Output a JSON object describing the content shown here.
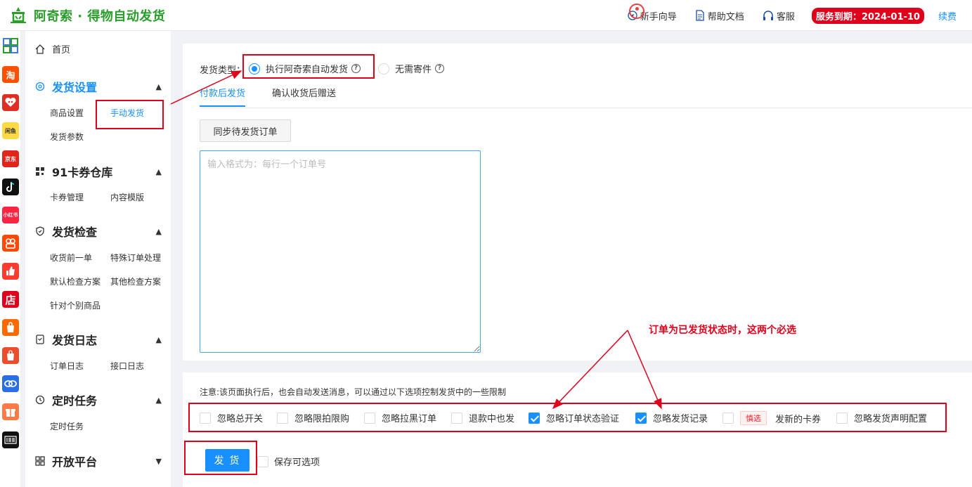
{
  "header": {
    "app_title": "阿奇索 · 得物自动发货",
    "guide": "新手向导",
    "docs": "帮助文档",
    "support": "客服",
    "service_expiry": "服务到期：2024-01-10",
    "renew": "续费"
  },
  "platforms": [
    {
      "icon": "grid-apps-icon",
      "label": "",
      "color": "#ffffff"
    },
    {
      "icon": "taobao-icon",
      "label": "淘",
      "color": "#ff5000"
    },
    {
      "icon": "pinduoduo-icon",
      "label": "",
      "color": "#e02e24"
    },
    {
      "icon": "xianyu-icon",
      "label": "闲鱼",
      "color": "#ffda44"
    },
    {
      "icon": "jd-icon",
      "label": "京东",
      "color": "#e1251b"
    },
    {
      "icon": "douyin-icon",
      "label": "",
      "color": "#111111"
    },
    {
      "icon": "xiaohongshu-icon",
      "label": "小红书",
      "color": "#ff2442"
    },
    {
      "icon": "kuaishou-icon",
      "label": "",
      "color": "#ff4906"
    },
    {
      "icon": "thumbs-up-icon",
      "label": "",
      "color": "#ff3b30"
    },
    {
      "icon": "shop-icon",
      "label": "店",
      "color": "#e0001b"
    },
    {
      "icon": "shopping-bag-icon",
      "label": "",
      "color": "#ff6a00"
    },
    {
      "icon": "shopee-icon",
      "label": "",
      "color": "#ee4d2d"
    },
    {
      "icon": "link-icon",
      "label": "",
      "color": "#2b6de5"
    },
    {
      "icon": "gift-icon",
      "label": "",
      "color": "#ff7a45"
    },
    {
      "icon": "dewu-icon",
      "label": "",
      "color": "#111111"
    }
  ],
  "sidebar": {
    "home": "首页",
    "groups": [
      {
        "title": "发货设置",
        "items": [
          "商品设置",
          "手动发货",
          "发货参数"
        ]
      },
      {
        "title": "91卡券仓库",
        "items": [
          "卡券管理",
          "内容模版"
        ]
      },
      {
        "title": "发货检查",
        "items": [
          "收货前一单",
          "特殊订单处理",
          "默认检查方案",
          "其他检查方案",
          "针对个别商品"
        ]
      },
      {
        "title": "发货日志",
        "items": [
          "订单日志",
          "接口日志"
        ]
      },
      {
        "title": "定时任务",
        "items": [
          "定时任务"
        ]
      },
      {
        "title": "开放平台",
        "items": []
      }
    ]
  },
  "main": {
    "ship_type_label": "发货类型：",
    "ship_type_options": [
      "执行阿奇索自动发货",
      "无需寄件"
    ],
    "ship_type_selected": 0,
    "tabs": [
      "付款后发货",
      "确认收货后赠送"
    ],
    "sync_button": "同步待发货订单",
    "order_input_placeholder": "输入格式为：每行一个订单号",
    "order_input_value": "",
    "notice": "注意:该页面执行后，也会自动发送消息，可以通过以下选项控制发货中的一些限制",
    "options": [
      {
        "label": "忽略总开关",
        "checked": false
      },
      {
        "label": "忽略限拍限购",
        "checked": false
      },
      {
        "label": "忽略拉黑订单",
        "checked": false
      },
      {
        "label": "退款中也发",
        "checked": false
      },
      {
        "label": "忽略订单状态验证",
        "checked": true
      },
      {
        "label": "忽略发货记录",
        "checked": true
      },
      {
        "label": "发新的卡券",
        "checked": false,
        "tag": "慎选"
      },
      {
        "label": "忽略发货声明配置",
        "checked": false
      }
    ],
    "ship_button": "发 货",
    "save_options": "保存可选项"
  },
  "annotation": {
    "text": "订单为已发货状态时，这两个必选",
    "color": "#e0001b"
  }
}
